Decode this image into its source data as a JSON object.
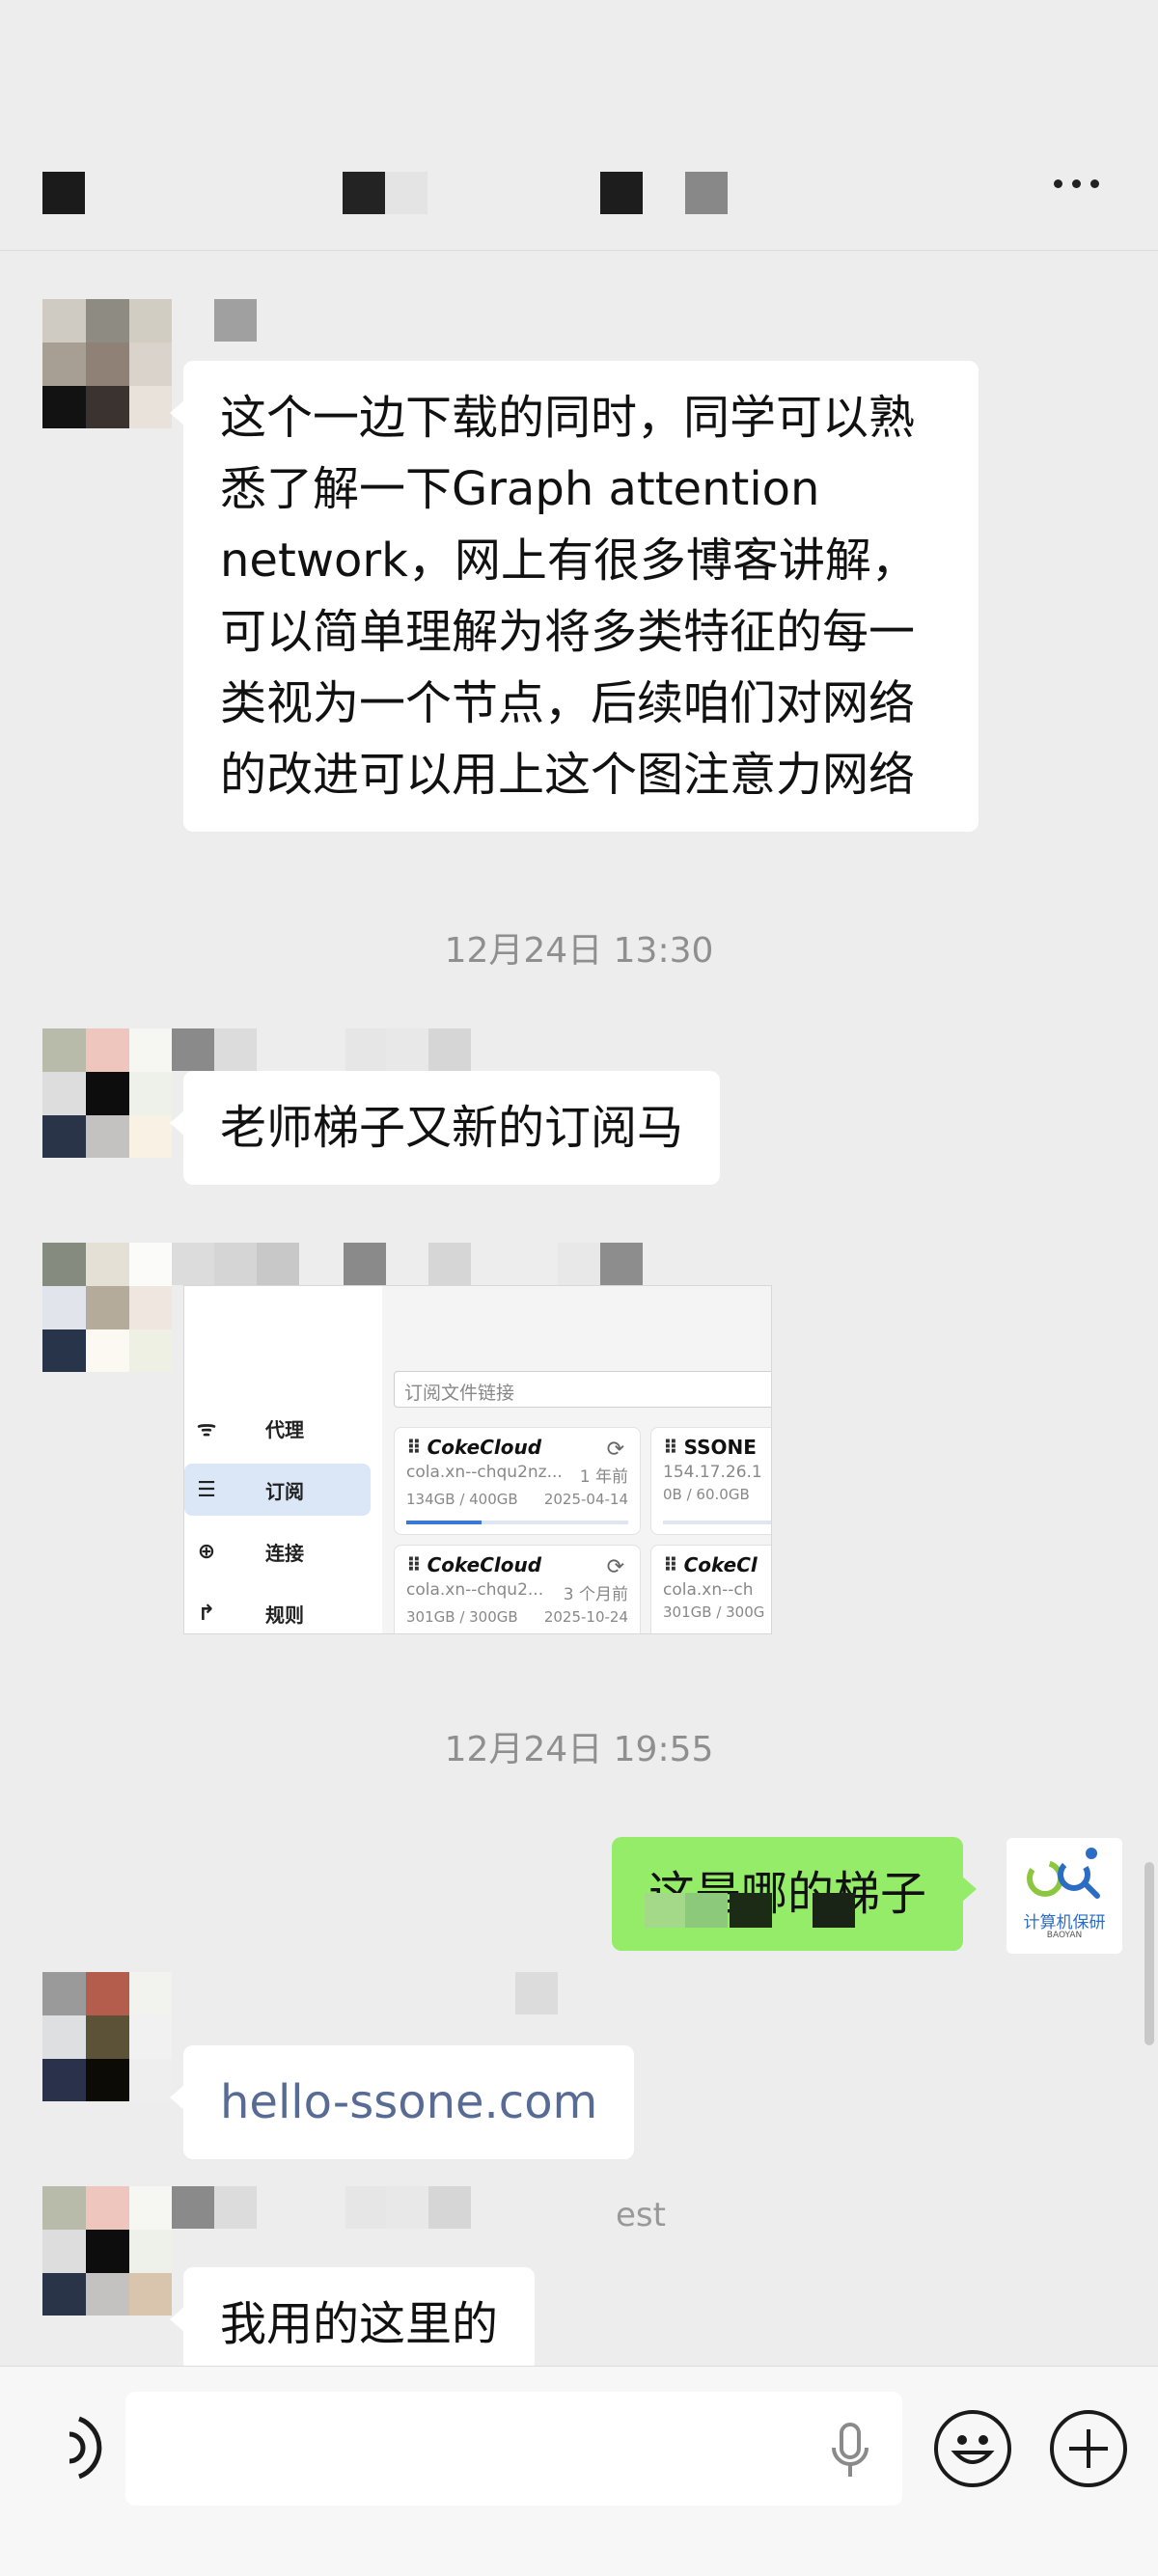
{
  "header": {
    "title_pixel_colors": [
      "#1b1b1b",
      "#232323",
      "#e4e4e4",
      "#1d1d1d",
      "#888888"
    ],
    "more_icon": "more-icon"
  },
  "messages": [
    {
      "id": "m1",
      "sender": "other",
      "avatar_colors": [
        "#cfcbc2",
        "#8d8b82",
        "#d1cdc3",
        "#a89f94",
        "#8f8175",
        "#d9d3cc",
        "#121212",
        "#3a3330",
        "#e8e2da"
      ],
      "name_colors": [
        "#a0a0a0"
      ],
      "lines": [
        "这个一边下载的同时，同学可以熟",
        "悉了解一下Graph attention",
        "network，网上有很多博客讲解，",
        "可以简单理解为将多类特征的每一",
        "类视为一个节点，后续咱们对网络",
        "的改进可以用上这个图注意力网络"
      ]
    },
    {
      "id": "ts1",
      "timestamp": "12月24日 13:30"
    },
    {
      "id": "m2",
      "sender": "other",
      "avatar_colors": [
        "#b9bbaa",
        "#efc6bd",
        "#f6f6f3",
        "#dddddd",
        "#0d0d0d",
        "#eef0ea",
        "#2a3448",
        "#c4c2c1",
        "#faf1e5"
      ],
      "name_colors": [
        "#8a8a8a",
        "#dcdcdc",
        "#e6e6e6",
        "#e8e8e8",
        "#d6d6d6"
      ],
      "text": "老师梯子又新的订阅马"
    },
    {
      "id": "m3",
      "sender": "other",
      "avatar_colors": [
        "#858b7e",
        "#e5e0d5",
        "#fbfbf9",
        "#e1e4ea",
        "#b4ab9a",
        "#efe6df",
        "#28344a",
        "#fbf9f1",
        "#eef0e3"
      ],
      "name_colors": [
        "#dcdcdc",
        "#d5d5d5",
        "#c8c8c8",
        "#8a8a8a",
        "#d6d6d6",
        "#e8e8e8",
        "#8d8d8d"
      ],
      "image": {
        "nav": [
          {
            "icon": "wifi-icon",
            "glyph": "ᯤ",
            "label": "代理",
            "active": false
          },
          {
            "icon": "server-icon",
            "glyph": "☰",
            "label": "订阅",
            "active": true
          },
          {
            "icon": "globe-icon",
            "glyph": "⊕",
            "label": "连接",
            "active": false
          },
          {
            "icon": "route-icon",
            "glyph": "↱",
            "label": "规则",
            "active": false
          }
        ],
        "url_placeholder": "订阅文件链接",
        "cards": [
          {
            "name": "CokeCloud",
            "host": "cola.xn--chqu2nz...",
            "age": "1 年前",
            "usage": "134GB / 400GB",
            "date": "2025-04-14",
            "used_fraction": 0.34
          },
          {
            "name": "SSONE",
            "host": "154.17.26.1",
            "age": "",
            "usage": "0B / 60.0GB",
            "date": "",
            "used_fraction": 0.0
          },
          {
            "name": "CokeCloud",
            "host": "cola.xn--chqu2...",
            "age": "3 个月前",
            "usage": "301GB / 300GB",
            "date": "2025-10-24",
            "used_fraction": 1.0
          },
          {
            "name": "CokeCl",
            "host": "cola.xn--ch",
            "age": "",
            "usage": "301GB / 300G",
            "date": "",
            "used_fraction": 1.0
          }
        ]
      }
    },
    {
      "id": "ts2",
      "timestamp": "12月24日 19:55"
    },
    {
      "id": "m4",
      "sender": "me",
      "text": "这是哪的梯子",
      "avatar_caption": "计算机保研",
      "avatar_sub": "BAOYAN"
    },
    {
      "id": "m5",
      "sender": "other",
      "avatar_colors": [
        "#9a9a9a",
        "#b55d4c",
        "#f2f3ef",
        "#dedfe0",
        "#5c5238",
        "#f1f1f1",
        "#29324a",
        "#0d0b06",
        "#eeeeee"
      ],
      "name_colors": [
        "#dcdcdc"
      ],
      "text": "hello-ssone.com",
      "is_link": true
    },
    {
      "id": "m6",
      "sender": "other",
      "avatar_colors": [
        "#b9bbaa",
        "#efc6bd",
        "#f6f6f3",
        "#dddddd",
        "#0d0d0d",
        "#eef0ea",
        "#2a3448",
        "#c4c2c1",
        "#d9c4ae"
      ],
      "name_colors": [
        "#8a8a8a",
        "#dcdcdc",
        "#e6e6e6",
        "#e8e8e8",
        "#d6d6d6"
      ],
      "name_fragment": "est",
      "text": "我用的这里的"
    }
  ],
  "footer": {
    "voice_icon": "voice-mode-icon",
    "mic_icon": "mic-icon",
    "emoji_icon": "emoji-icon",
    "plus_icon": "plus-icon"
  }
}
